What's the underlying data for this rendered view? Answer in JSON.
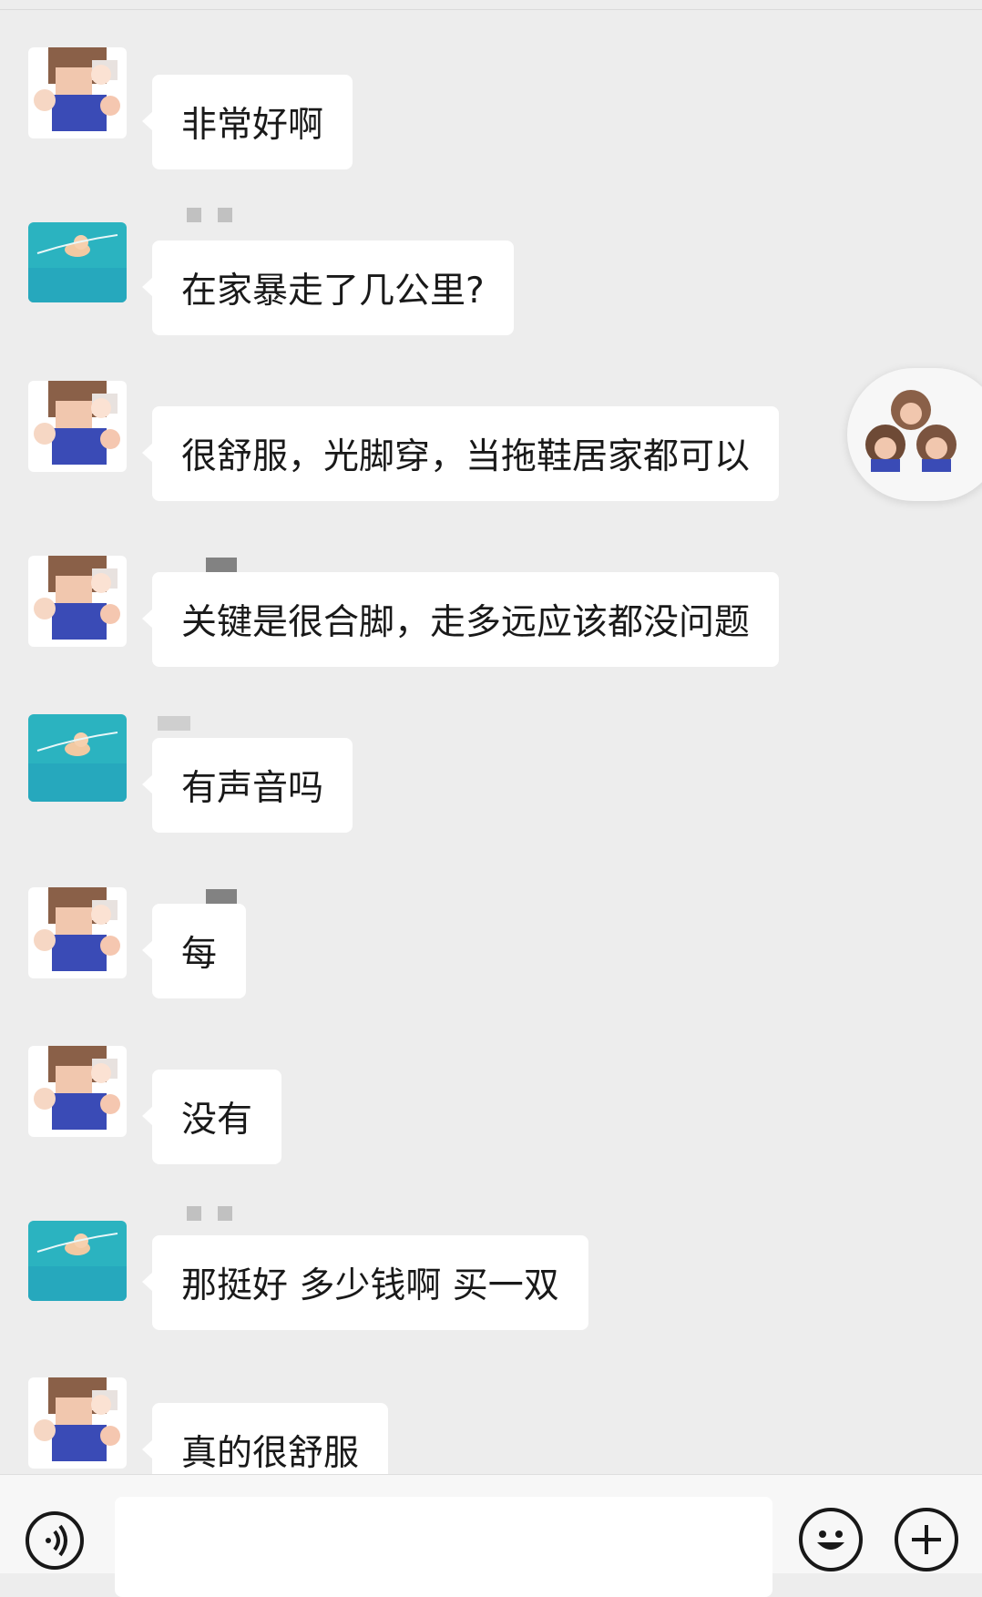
{
  "messages": [
    {
      "text": "非常好啊",
      "sender": "A"
    },
    {
      "text": "在家暴走了几公里?",
      "sender": "B"
    },
    {
      "text": "很舒服，光脚穿，当拖鞋居家都可以",
      "sender": "A"
    },
    {
      "text": "关键是很合脚，走多远应该都没问题",
      "sender": "A"
    },
    {
      "text": "有声音吗",
      "sender": "B"
    },
    {
      "text": "每",
      "sender": "A"
    },
    {
      "text": "没有",
      "sender": "A"
    },
    {
      "text": "那挺好 多少钱啊 买一双",
      "sender": "B"
    },
    {
      "text": "真的很舒服",
      "sender": "A"
    }
  ],
  "icons": {
    "voice": "voice-icon",
    "emoji": "emoji-icon",
    "plus": "plus-icon",
    "floating": "floating-chat-avatar"
  },
  "colors": {
    "background": "#ededed",
    "bubble": "#ffffff",
    "text": "#191919",
    "teal_avatar": "#2bb3c0"
  }
}
